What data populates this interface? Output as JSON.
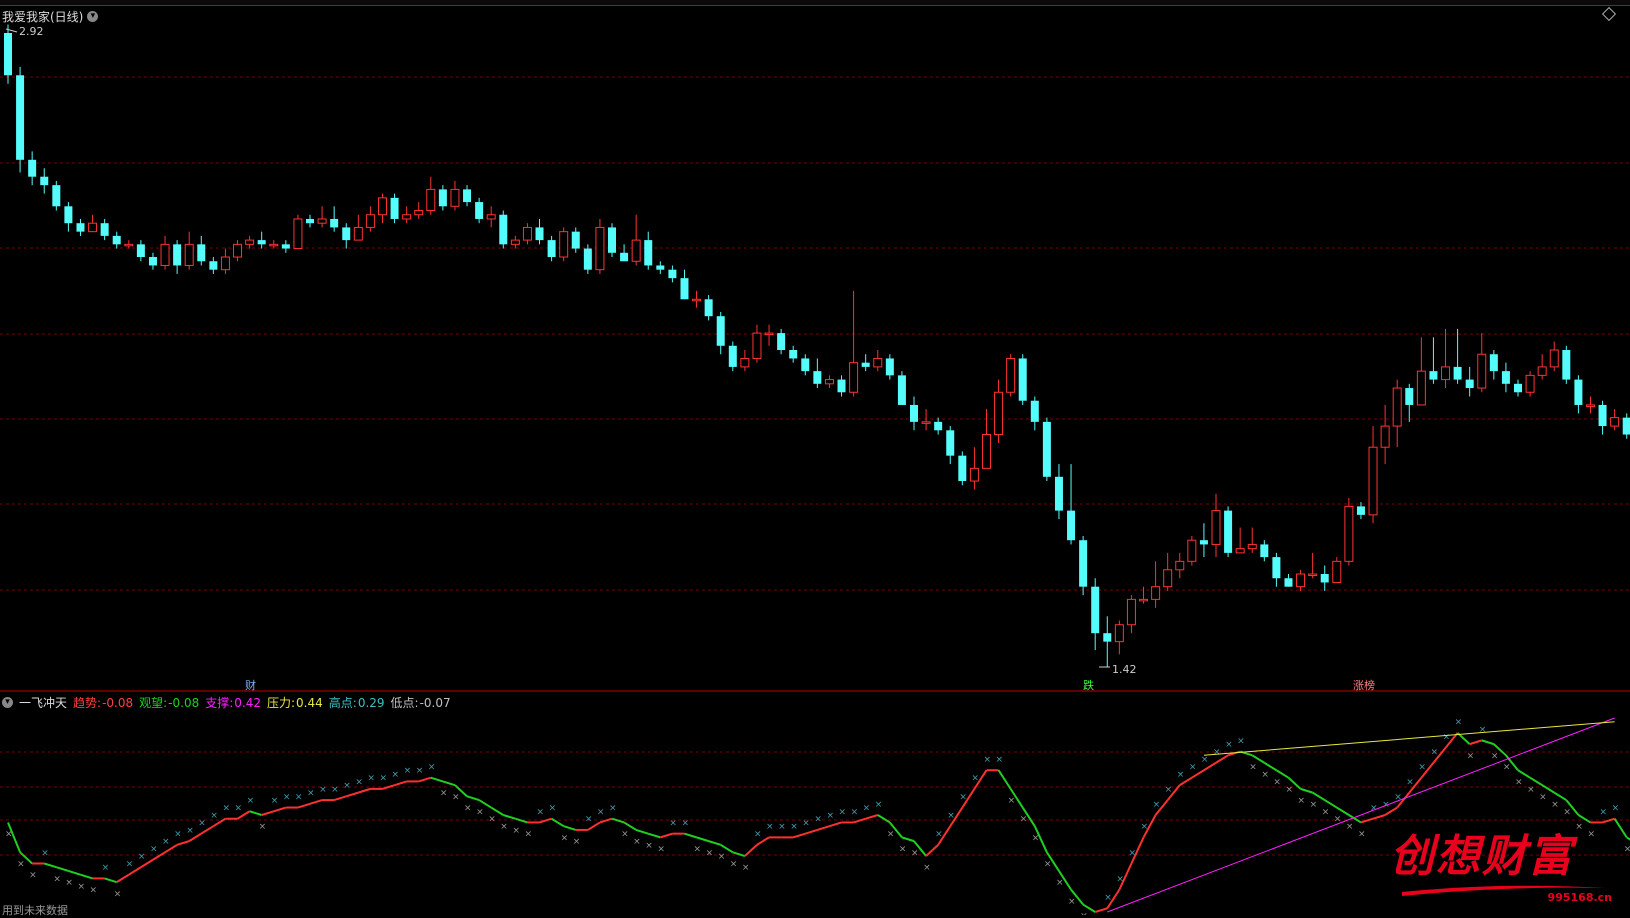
{
  "header": {
    "title": "我爱我家(日线)",
    "high_label": "2.92",
    "low_label": "1.42"
  },
  "markers": {
    "m1": "财",
    "m2": "跌",
    "m3": "涨榜"
  },
  "indicator": {
    "name": "一飞冲天",
    "items": [
      {
        "label": "趋势:",
        "value": "-0.08",
        "color": "#ff4040"
      },
      {
        "label": "观望:",
        "value": "-0.08",
        "color": "#20d020"
      },
      {
        "label": "支撑:",
        "value": "0.42",
        "color": "#ff20ff"
      },
      {
        "label": "压力:",
        "value": "0.44",
        "color": "#e8e840"
      },
      {
        "label": "高点:",
        "value": "0.29",
        "color": "#40c0c0"
      },
      {
        "label": "低点:",
        "value": "-0.07",
        "color": "#c0c0c0"
      }
    ]
  },
  "footer": {
    "note": "用到未来数据"
  },
  "logo": {
    "text": "创想财富",
    "url": "995168.cn"
  },
  "colors": {
    "up": "#ff3232",
    "down": "#54fcfc",
    "grid": "#7a0000",
    "divider": "#c00000"
  },
  "chart_data": {
    "type": "candlestick",
    "price_panel": {
      "ymin": 1.42,
      "ymax": 2.92
    },
    "candles": [
      [
        2.92,
        2.82,
        2.94,
        2.8
      ],
      [
        2.82,
        2.62,
        2.84,
        2.59
      ],
      [
        2.62,
        2.58,
        2.64,
        2.56
      ],
      [
        2.58,
        2.56,
        2.6,
        2.54
      ],
      [
        2.56,
        2.51,
        2.57,
        2.5
      ],
      [
        2.51,
        2.47,
        2.52,
        2.45
      ],
      [
        2.47,
        2.45,
        2.48,
        2.44
      ],
      [
        2.45,
        2.47,
        2.49,
        2.45
      ],
      [
        2.47,
        2.44,
        2.48,
        2.43
      ],
      [
        2.44,
        2.42,
        2.45,
        2.41
      ],
      [
        2.42,
        2.42,
        2.43,
        2.41
      ],
      [
        2.42,
        2.39,
        2.43,
        2.38
      ],
      [
        2.39,
        2.37,
        2.4,
        2.36
      ],
      [
        2.37,
        2.42,
        2.44,
        2.36
      ],
      [
        2.42,
        2.37,
        2.43,
        2.35
      ],
      [
        2.37,
        2.42,
        2.45,
        2.36
      ],
      [
        2.42,
        2.38,
        2.44,
        2.37
      ],
      [
        2.38,
        2.36,
        2.39,
        2.35
      ],
      [
        2.36,
        2.39,
        2.41,
        2.35
      ],
      [
        2.39,
        2.42,
        2.43,
        2.38
      ],
      [
        2.42,
        2.43,
        2.44,
        2.41
      ],
      [
        2.43,
        2.42,
        2.45,
        2.41
      ],
      [
        2.42,
        2.42,
        2.43,
        2.41
      ],
      [
        2.42,
        2.41,
        2.43,
        2.4
      ],
      [
        2.41,
        2.48,
        2.49,
        2.41
      ],
      [
        2.48,
        2.47,
        2.49,
        2.46
      ],
      [
        2.47,
        2.48,
        2.51,
        2.46
      ],
      [
        2.48,
        2.46,
        2.51,
        2.45
      ],
      [
        2.46,
        2.43,
        2.47,
        2.41
      ],
      [
        2.43,
        2.46,
        2.49,
        2.43
      ],
      [
        2.46,
        2.49,
        2.51,
        2.45
      ],
      [
        2.49,
        2.53,
        2.54,
        2.47
      ],
      [
        2.53,
        2.48,
        2.54,
        2.47
      ],
      [
        2.48,
        2.49,
        2.51,
        2.47
      ],
      [
        2.49,
        2.5,
        2.52,
        2.48
      ],
      [
        2.5,
        2.55,
        2.58,
        2.49
      ],
      [
        2.55,
        2.51,
        2.56,
        2.5
      ],
      [
        2.51,
        2.55,
        2.57,
        2.5
      ],
      [
        2.55,
        2.52,
        2.56,
        2.51
      ],
      [
        2.52,
        2.48,
        2.53,
        2.47
      ],
      [
        2.48,
        2.49,
        2.51,
        2.46
      ],
      [
        2.49,
        2.42,
        2.5,
        2.41
      ],
      [
        2.42,
        2.43,
        2.44,
        2.41
      ],
      [
        2.43,
        2.46,
        2.47,
        2.42
      ],
      [
        2.46,
        2.43,
        2.48,
        2.42
      ],
      [
        2.43,
        2.39,
        2.44,
        2.38
      ],
      [
        2.39,
        2.45,
        2.46,
        2.38
      ],
      [
        2.45,
        2.41,
        2.46,
        2.4
      ],
      [
        2.41,
        2.36,
        2.42,
        2.35
      ],
      [
        2.36,
        2.46,
        2.48,
        2.35
      ],
      [
        2.46,
        2.4,
        2.47,
        2.39
      ],
      [
        2.4,
        2.38,
        2.42,
        2.38
      ],
      [
        2.38,
        2.43,
        2.49,
        2.37
      ],
      [
        2.43,
        2.37,
        2.45,
        2.36
      ],
      [
        2.37,
        2.36,
        2.38,
        2.35
      ],
      [
        2.36,
        2.34,
        2.37,
        2.33
      ],
      [
        2.34,
        2.29,
        2.36,
        2.29
      ],
      [
        2.29,
        2.29,
        2.31,
        2.27
      ],
      [
        2.29,
        2.25,
        2.3,
        2.24
      ],
      [
        2.25,
        2.18,
        2.26,
        2.16
      ],
      [
        2.18,
        2.13,
        2.19,
        2.12
      ],
      [
        2.13,
        2.15,
        2.17,
        2.12
      ],
      [
        2.15,
        2.21,
        2.23,
        2.14
      ],
      [
        2.21,
        2.21,
        2.23,
        2.18
      ],
      [
        2.21,
        2.17,
        2.22,
        2.16
      ],
      [
        2.17,
        2.15,
        2.18,
        2.14
      ],
      [
        2.15,
        2.12,
        2.16,
        2.11
      ],
      [
        2.12,
        2.09,
        2.15,
        2.08
      ],
      [
        2.09,
        2.1,
        2.11,
        2.08
      ],
      [
        2.1,
        2.07,
        2.11,
        2.06
      ],
      [
        2.07,
        2.14,
        2.31,
        2.06
      ],
      [
        2.14,
        2.13,
        2.16,
        2.12
      ],
      [
        2.13,
        2.15,
        2.17,
        2.12
      ],
      [
        2.15,
        2.11,
        2.16,
        2.1
      ],
      [
        2.11,
        2.04,
        2.12,
        2.04
      ],
      [
        2.04,
        2.0,
        2.06,
        1.98
      ],
      [
        2.0,
        2.0,
        2.03,
        1.98
      ],
      [
        2.0,
        1.98,
        2.01,
        1.97
      ],
      [
        1.98,
        1.92,
        1.99,
        1.9
      ],
      [
        1.92,
        1.86,
        1.93,
        1.85
      ],
      [
        1.86,
        1.89,
        1.94,
        1.84
      ],
      [
        1.89,
        1.97,
        2.03,
        1.89
      ],
      [
        1.97,
        2.07,
        2.1,
        1.95
      ],
      [
        2.07,
        2.15,
        2.16,
        2.06
      ],
      [
        2.15,
        2.05,
        2.16,
        2.04
      ],
      [
        2.05,
        2.0,
        2.06,
        1.98
      ],
      [
        2.0,
        1.87,
        2.01,
        1.86
      ],
      [
        1.87,
        1.79,
        1.9,
        1.77
      ],
      [
        1.79,
        1.72,
        1.9,
        1.71
      ],
      [
        1.72,
        1.61,
        1.73,
        1.59
      ],
      [
        1.61,
        1.5,
        1.63,
        1.46
      ],
      [
        1.5,
        1.48,
        1.54,
        1.42
      ],
      [
        1.48,
        1.52,
        1.53,
        1.45
      ],
      [
        1.52,
        1.58,
        1.59,
        1.5
      ],
      [
        1.58,
        1.58,
        1.61,
        1.57
      ],
      [
        1.58,
        1.61,
        1.67,
        1.56
      ],
      [
        1.61,
        1.65,
        1.69,
        1.6
      ],
      [
        1.65,
        1.67,
        1.69,
        1.63
      ],
      [
        1.67,
        1.72,
        1.73,
        1.66
      ],
      [
        1.72,
        1.71,
        1.76,
        1.68
      ],
      [
        1.71,
        1.79,
        1.83,
        1.68
      ],
      [
        1.79,
        1.69,
        1.8,
        1.68
      ],
      [
        1.69,
        1.7,
        1.75,
        1.69
      ],
      [
        1.7,
        1.71,
        1.75,
        1.69
      ],
      [
        1.71,
        1.68,
        1.72,
        1.67
      ],
      [
        1.68,
        1.63,
        1.69,
        1.61
      ],
      [
        1.63,
        1.61,
        1.64,
        1.61
      ],
      [
        1.61,
        1.64,
        1.65,
        1.6
      ],
      [
        1.64,
        1.64,
        1.69,
        1.63
      ],
      [
        1.64,
        1.62,
        1.66,
        1.6
      ],
      [
        1.62,
        1.67,
        1.68,
        1.62
      ],
      [
        1.67,
        1.8,
        1.82,
        1.66
      ],
      [
        1.8,
        1.78,
        1.81,
        1.77
      ],
      [
        1.78,
        1.94,
        1.99,
        1.76
      ],
      [
        1.94,
        1.99,
        2.04,
        1.9
      ],
      [
        1.99,
        2.08,
        2.1,
        1.94
      ],
      [
        2.08,
        2.04,
        2.09,
        2.0
      ],
      [
        2.04,
        2.12,
        2.2,
        2.04
      ],
      [
        2.12,
        2.1,
        2.2,
        2.09
      ],
      [
        2.1,
        2.13,
        2.22,
        2.08
      ],
      [
        2.13,
        2.1,
        2.22,
        2.09
      ],
      [
        2.1,
        2.08,
        2.13,
        2.06
      ],
      [
        2.08,
        2.16,
        2.21,
        2.07
      ],
      [
        2.16,
        2.12,
        2.17,
        2.1
      ],
      [
        2.12,
        2.09,
        2.14,
        2.07
      ],
      [
        2.09,
        2.07,
        2.1,
        2.06
      ],
      [
        2.07,
        2.11,
        2.12,
        2.06
      ],
      [
        2.11,
        2.13,
        2.16,
        2.1
      ],
      [
        2.13,
        2.17,
        2.19,
        2.12
      ],
      [
        2.17,
        2.1,
        2.18,
        2.09
      ],
      [
        2.1,
        2.04,
        2.11,
        2.02
      ],
      [
        2.04,
        2.04,
        2.06,
        2.02
      ],
      [
        2.04,
        1.99,
        2.05,
        1.97
      ],
      [
        1.99,
        2.01,
        2.03,
        1.98
      ],
      [
        2.01,
        1.97,
        2.02,
        1.96
      ]
    ],
    "indicator_panel": {
      "ymin": -0.08,
      "ymax": 0.44,
      "trend_line": [
        0.16,
        0.08,
        0.05,
        0.05,
        0.04,
        0.03,
        0.02,
        0.01,
        0.01,
        0.0,
        0.02,
        0.04,
        0.06,
        0.08,
        0.1,
        0.11,
        0.13,
        0.15,
        0.17,
        0.17,
        0.19,
        0.18,
        0.19,
        0.2,
        0.2,
        0.21,
        0.22,
        0.22,
        0.23,
        0.24,
        0.25,
        0.25,
        0.26,
        0.27,
        0.27,
        0.28,
        0.27,
        0.26,
        0.23,
        0.22,
        0.2,
        0.18,
        0.17,
        0.16,
        0.16,
        0.17,
        0.15,
        0.14,
        0.14,
        0.16,
        0.17,
        0.16,
        0.14,
        0.13,
        0.12,
        0.13,
        0.13,
        0.12,
        0.11,
        0.1,
        0.08,
        0.07,
        0.1,
        0.12,
        0.12,
        0.12,
        0.13,
        0.14,
        0.15,
        0.16,
        0.16,
        0.17,
        0.18,
        0.16,
        0.12,
        0.11,
        0.07,
        0.1,
        0.15,
        0.2,
        0.25,
        0.3,
        0.3,
        0.25,
        0.2,
        0.15,
        0.08,
        0.03,
        -0.02,
        -0.06,
        -0.08,
        -0.07,
        -0.02,
        0.05,
        0.12,
        0.18,
        0.22,
        0.26,
        0.28,
        0.3,
        0.32,
        0.34,
        0.35,
        0.34,
        0.32,
        0.3,
        0.28,
        0.25,
        0.24,
        0.22,
        0.2,
        0.18,
        0.16,
        0.17,
        0.18,
        0.2,
        0.24,
        0.28,
        0.32,
        0.36,
        0.4,
        0.37,
        0.38,
        0.37,
        0.34,
        0.3,
        0.28,
        0.26,
        0.24,
        0.22,
        0.18,
        0.16,
        0.16,
        0.17,
        0.12,
        0.1,
        0.09
      ],
      "support_line": {
        "from": [
          91,
          -0.08
        ],
        "to": [
          133,
          0.44
        ]
      },
      "pressure_line": {
        "from": [
          99,
          0.34
        ],
        "to": [
          133,
          0.43
        ]
      }
    }
  }
}
